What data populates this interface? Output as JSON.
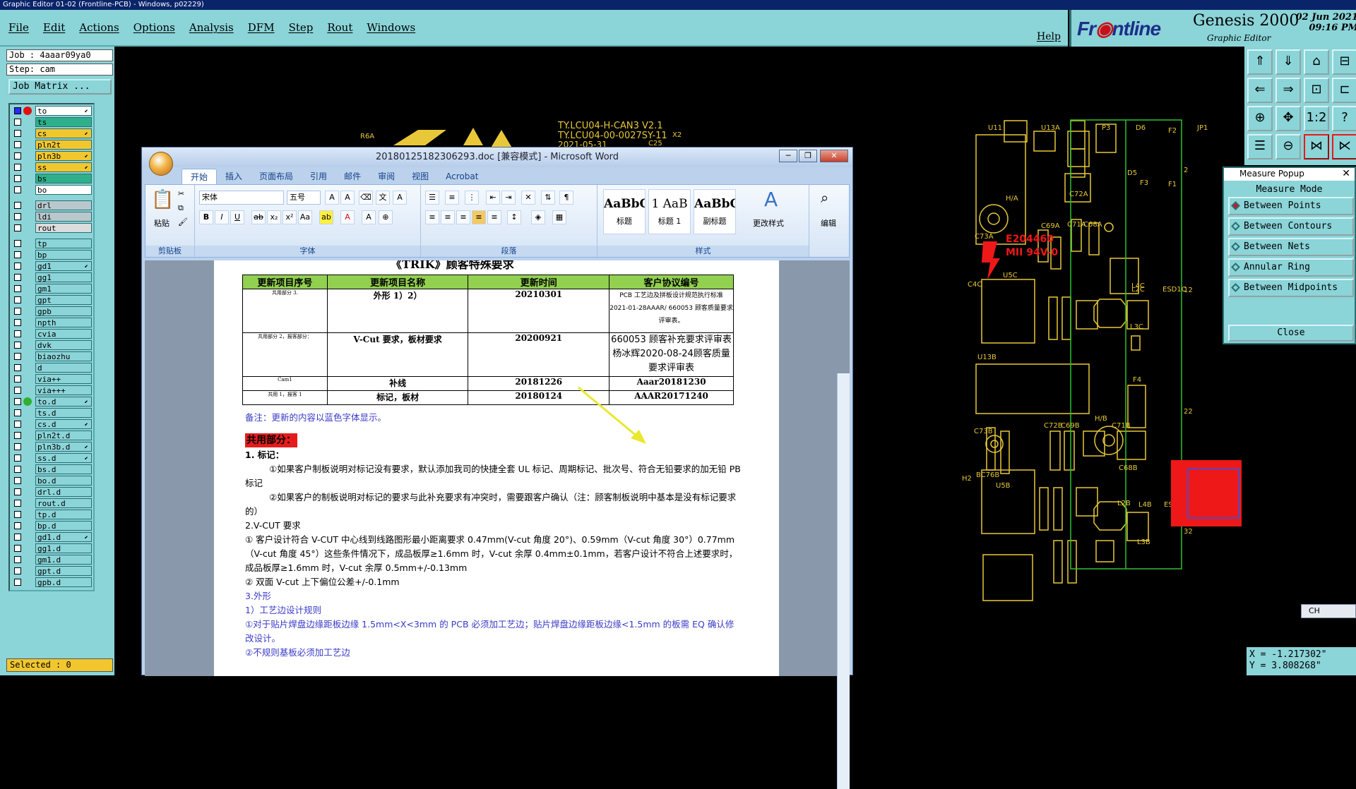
{
  "app_title": "Graphic Editor 01-02 (Frontline-PCB) - Windows, p02229)",
  "menu": {
    "items": [
      "File",
      "Edit",
      "Actions",
      "Options",
      "Analysis",
      "DFM",
      "Step",
      "Rout",
      "Windows"
    ],
    "help": "Help"
  },
  "brand": {
    "logo_front": "Fr",
    "logo_rest": "ntline",
    "product": "Genesis 2000",
    "subtitle": "Graphic Editor",
    "date": "02 Jun 2021",
    "time": "09:16 PM"
  },
  "job": {
    "job_line": "Job : 4aaar09ya0",
    "step_line": "Step: cam",
    "matrix_btn": "Job Matrix ..."
  },
  "layers": [
    {
      "name": "to",
      "color": "#ffffff",
      "dot": "#e01010",
      "mark": "⬋"
    },
    {
      "name": "ts",
      "color": "#2fb08a",
      "dot": "",
      "mark": ""
    },
    {
      "name": "cs",
      "color": "#f2c72e",
      "dot": "",
      "mark": "⬋"
    },
    {
      "name": "pln2t",
      "color": "#f2c72e",
      "dot": "",
      "mark": ""
    },
    {
      "name": "pln3b",
      "color": "#f2c72e",
      "dot": "",
      "mark": "⬋"
    },
    {
      "name": "ss",
      "color": "#f2c72e",
      "dot": "",
      "mark": "⬋"
    },
    {
      "name": "bs",
      "color": "#2fb08a",
      "dot": "",
      "mark": ""
    },
    {
      "name": "bo",
      "color": "#ffffff",
      "dot": "",
      "mark": ""
    },
    {
      "name": "drl",
      "color": "#b8c8cc",
      "dot": "",
      "mark": ""
    },
    {
      "name": "ldi",
      "color": "#b8c8cc",
      "dot": "",
      "mark": ""
    },
    {
      "name": "rout",
      "color": "#dcdcdc",
      "dot": "",
      "mark": ""
    },
    {
      "name": "tp",
      "color": "#8bd4d8",
      "dot": "",
      "mark": ""
    },
    {
      "name": "bp",
      "color": "#8bd4d8",
      "dot": "",
      "mark": ""
    },
    {
      "name": "gd1",
      "color": "#8bd4d8",
      "dot": "",
      "mark": "⬋"
    },
    {
      "name": "gg1",
      "color": "#8bd4d8",
      "dot": "",
      "mark": ""
    },
    {
      "name": "gm1",
      "color": "#8bd4d8",
      "dot": "",
      "mark": ""
    },
    {
      "name": "gpt",
      "color": "#8bd4d8",
      "dot": "",
      "mark": ""
    },
    {
      "name": "gpb",
      "color": "#8bd4d8",
      "dot": "",
      "mark": ""
    },
    {
      "name": "npth",
      "color": "#8bd4d8",
      "dot": "",
      "mark": ""
    },
    {
      "name": "cvia",
      "color": "#8bd4d8",
      "dot": "",
      "mark": ""
    },
    {
      "name": "dvk",
      "color": "#8bd4d8",
      "dot": "",
      "mark": ""
    },
    {
      "name": "biaozhu",
      "color": "#8bd4d8",
      "dot": "",
      "mark": ""
    },
    {
      "name": "d",
      "color": "#8bd4d8",
      "dot": "",
      "mark": ""
    },
    {
      "name": "via++",
      "color": "#8bd4d8",
      "dot": "",
      "mark": ""
    },
    {
      "name": "via+++",
      "color": "#8bd4d8",
      "dot": "",
      "mark": ""
    },
    {
      "name": "to.d",
      "color": "#8bd4d8",
      "dot": "#2fb030",
      "mark": "⬋"
    },
    {
      "name": "ts.d",
      "color": "#8bd4d8",
      "dot": "",
      "mark": ""
    },
    {
      "name": "cs.d",
      "color": "#8bd4d8",
      "dot": "",
      "mark": "⬋"
    },
    {
      "name": "pln2t.d",
      "color": "#8bd4d8",
      "dot": "",
      "mark": ""
    },
    {
      "name": "pln3b.d",
      "color": "#8bd4d8",
      "dot": "",
      "mark": "⬋"
    },
    {
      "name": "ss.d",
      "color": "#8bd4d8",
      "dot": "",
      "mark": "⬋"
    },
    {
      "name": "bs.d",
      "color": "#8bd4d8",
      "dot": "",
      "mark": ""
    },
    {
      "name": "bo.d",
      "color": "#8bd4d8",
      "dot": "",
      "mark": ""
    },
    {
      "name": "drl.d",
      "color": "#8bd4d8",
      "dot": "",
      "mark": ""
    },
    {
      "name": "rout.d",
      "color": "#8bd4d8",
      "dot": "",
      "mark": ""
    },
    {
      "name": "tp.d",
      "color": "#8bd4d8",
      "dot": "",
      "mark": ""
    },
    {
      "name": "bp.d",
      "color": "#8bd4d8",
      "dot": "",
      "mark": ""
    },
    {
      "name": "gd1.d",
      "color": "#8bd4d8",
      "dot": "",
      "mark": "⬋"
    },
    {
      "name": "gg1.d",
      "color": "#8bd4d8",
      "dot": "",
      "mark": ""
    },
    {
      "name": "gm1.d",
      "color": "#8bd4d8",
      "dot": "",
      "mark": ""
    },
    {
      "name": "gpt.d",
      "color": "#8bd4d8",
      "dot": "",
      "mark": ""
    },
    {
      "name": "gpb.d",
      "color": "#8bd4d8",
      "dot": "",
      "mark": ""
    }
  ],
  "selected": "Selected : 0",
  "board_labels": {
    "l1": "TY.LCU04-H-CAN3 V2.1",
    "l2": "TY.LCU04-00-0027SY-11",
    "l3": "2021-05-31",
    "x2": "X2",
    "r6a": "R6A",
    "c25": "C25",
    "u11": "U11",
    "u13a": "U13A",
    "p3": "P3",
    "d6": "D6",
    "f2a": "F2",
    "f1": "F1",
    "f3": "F3",
    "d5": "D5",
    "jp1": "JP1",
    "c72a": "C72A",
    "c69a": "C69A",
    "c71a": "C71A",
    "c68a": "C68A",
    "c73a": "C73A",
    "h4": "H/A",
    "e1": "E204460",
    "e2": "MII 94V-0",
    "u5c": "U5C",
    "c4c": "C4C",
    "l2c": "L2C",
    "esd1c": "ESD1C",
    "l4c": "L4C",
    "l3c": "L3C",
    "u13b": "U13B",
    "f4": "F4",
    "c71b": "C71B",
    "c72b": "C72B",
    "c69b": "C69B",
    "c73b": "C73B",
    "hb": "H/B",
    "c68b": "C68B",
    "bc76b": "BC76B",
    "u5b": "U5B",
    "l2b": "L2B",
    "l4b": "L4B",
    "esd1b": "ESD1B",
    "l3b": "L3B",
    "n12": "12",
    "n22": "22",
    "n32": "32",
    "n2": "2",
    "h2": "H2"
  },
  "measure": {
    "title": "Measure Popup",
    "mode_label": "Measure Mode",
    "options": [
      "Between Points",
      "Between Contours",
      "Between Nets",
      "Annular Ring",
      "Between Midpoints"
    ],
    "close": "Close"
  },
  "coords": {
    "x": "X = -1.217302\"",
    "y": "Y = 3.808268\""
  },
  "ime": "CH",
  "tool_icons": [
    "home-up-icon",
    "home-down-icon",
    "house-icon",
    "step-icon",
    "slide-left-icon",
    "slide-right-icon",
    "zoom-icon",
    "step-out-icon",
    "fit-icon",
    "center-icon",
    "ratio-icon",
    "help-icon",
    "layers-icon",
    "measure-icon",
    "snap-icon",
    "snap2-icon"
  ],
  "tool_ratio": "1:2",
  "tool_help": "?",
  "word": {
    "title": "20180125182306293.doc [兼容模式] - Microsoft Word",
    "tabs": [
      "开始",
      "插入",
      "页面布局",
      "引用",
      "邮件",
      "审阅",
      "视图",
      "Acrobat"
    ],
    "groups": {
      "clipboard": "剪贴板",
      "font": "字体",
      "paragraph": "段落",
      "styles": "样式"
    },
    "paste": "粘贴",
    "font_name": "宋体",
    "font_size": "五号",
    "styles": [
      {
        "sample": "AaBbC",
        "name": "标题"
      },
      {
        "sample": "1 AaB",
        "name": "标题 1"
      },
      {
        "sample": "AaBbC",
        "name": "副标题"
      }
    ],
    "change_styles": "更改样式",
    "edit": "编辑",
    "heading_partial": "《TRIK》顾客特殊要求",
    "table": {
      "headers": [
        "更新项目序号",
        "更新项目名称",
        "更新时间",
        "客户协议编号"
      ],
      "rows": [
        {
          "no": "共用部分 3.",
          "name": "外形 1）2）",
          "date": "20210301",
          "code": "PCB 工艺边及拼板设计规范执行标准 2021-01-28AAAR/ 660053 顾客质量要求评审表。"
        },
        {
          "no": "共用部分 2，报客部分：",
          "name": "V-Cut 要求，板材要求",
          "date": "20200921",
          "code": "660053 顾客补充要求评审表杨冰辉2020-08-24顾客质量要求评审表"
        },
        {
          "no": "Cam1",
          "name": "补线",
          "date": "20181226",
          "code": "Aaar20181230"
        },
        {
          "no": "共用 1，报客 1",
          "name": "标记，板材",
          "date": "20180124",
          "code": "AAAR20171240"
        }
      ]
    },
    "note": "备注：更新的内容以蓝色字体显示。",
    "shared": "共用部分：",
    "mark_title": "1. 标记：",
    "p1": "①如果客户制板说明对标记没有要求，默认添加我司的快捷全套 UL 标记、周期标记、批次号、符合无铅要求的加无铅 PB 标记",
    "p2": "②如果客户的制板说明对标记的要求与此补充要求有冲突时，需要跟客户确认（注：顾客制板说明中基本是没有标记要求的）",
    "vcut_title": "2.V-CUT 要求",
    "p3": "① 客户设计符合 V-CUT 中心线到线路图形最小距离要求 0.47mm(V-cut 角度 20°)、0.59mm（V-cut 角度 30°）0.77mm（V-cut 角度 45°）这些条件情况下，成品板厚≥1.6mm 时，V-cut 余厚 0.4mm±0.1mm，若客户设计不符合上述要求时，成品板厚≥1.6mm 时，V-cut 余厚 0.5mm+/-0.13mm",
    "p4": "② 双面 V-cut 上下偏位公差+/-0.1mm",
    "shape_title": "3.外形",
    "p5": "1）工艺边设计规则",
    "p6": "①对于贴片焊盘边缘距板边缘 1.5mm<X<3mm 的 PCB 必须加工艺边；贴片焊盘边缘距板边缘<1.5mm 的板需 EQ 确认修改设计。",
    "p7": "②不规则基板必须加工艺边"
  }
}
